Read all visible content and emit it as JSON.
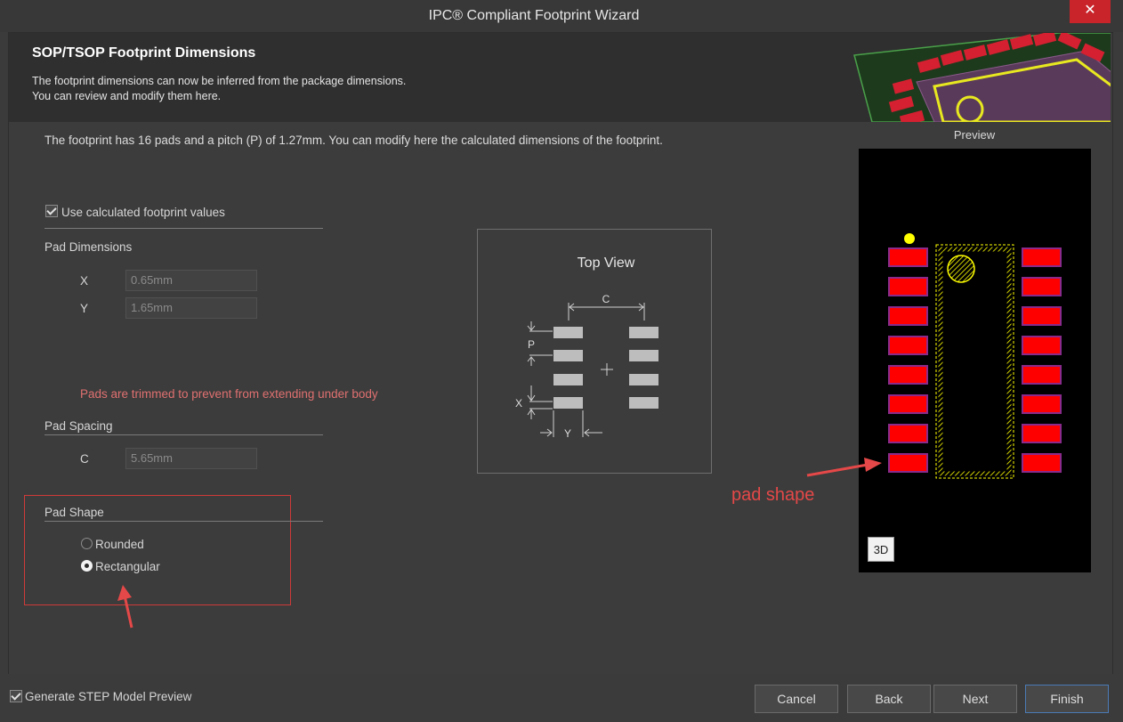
{
  "window": {
    "title": "IPC® Compliant Footprint Wizard",
    "close_glyph": "✕"
  },
  "header": {
    "title": "SOP/TSOP Footprint Dimensions",
    "desc1": "The footprint dimensions can now be inferred from the package dimensions.",
    "desc2": "You can review and modify them here."
  },
  "info": "The footprint has 16 pads and a pitch (P) of 1.27mm. You can modify here the calculated dimensions of the footprint.",
  "use_calc": {
    "label": "Use calculated footprint values",
    "checked": true
  },
  "pad_dimensions": {
    "label": "Pad Dimensions",
    "x_label": "X",
    "x_value": "0.65mm",
    "y_label": "Y",
    "y_value": "1.65mm"
  },
  "warning": "Pads are trimmed to prevent from extending under body",
  "pad_spacing": {
    "label": "Pad Spacing",
    "c_label": "C",
    "c_value": "5.65mm"
  },
  "pad_shape": {
    "label": "Pad Shape",
    "options": [
      {
        "label": "Rounded",
        "selected": false
      },
      {
        "label": "Rectangular",
        "selected": true
      }
    ]
  },
  "topview": {
    "title": "Top View",
    "c": "C",
    "p": "P",
    "x": "X",
    "y": "Y"
  },
  "preview": {
    "label": "Preview",
    "btn_3d": "3D"
  },
  "annotation": "pad shape",
  "footer": {
    "generate_step": {
      "label": "Generate STEP Model Preview",
      "checked": true
    },
    "cancel": "Cancel",
    "back": "Back",
    "next": "Next",
    "finish": "Finish"
  },
  "colors": {
    "pad": "#ff0000",
    "pad_outline": "#8a2a8a",
    "silk": "#ffff00",
    "annotation": "#e54848",
    "accent": "#4b7bb6"
  }
}
